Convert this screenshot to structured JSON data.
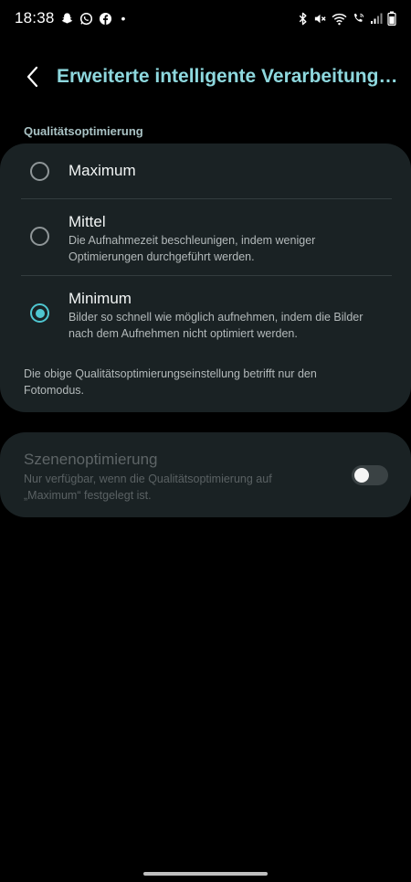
{
  "status_bar": {
    "time": "18:38",
    "left_icons": [
      "snapchat-icon",
      "whatsapp-icon",
      "facebook-icon",
      "notification-dot-icon"
    ],
    "right_icons": [
      "bluetooth-icon",
      "mute-icon",
      "wifi-icon",
      "wifi-call-icon",
      "signal-icon",
      "battery-icon"
    ],
    "dot": "•"
  },
  "header": {
    "back_icon": "chevron-left-icon",
    "title": "Erweiterte intelligente Verarbeitungso..."
  },
  "quality_section": {
    "label": "Qualitätsoptimierung",
    "options": [
      {
        "title": "Maximum",
        "description": "",
        "selected": false
      },
      {
        "title": "Mittel",
        "description": "Die Aufnahmezeit beschleunigen, indem weniger Optimierungen durchgeführt werden.",
        "selected": false
      },
      {
        "title": "Minimum",
        "description": "Bilder so schnell wie möglich aufnehmen, indem die Bilder nach dem Aufnehmen nicht optimiert werden.",
        "selected": true
      }
    ],
    "footnote": "Die obige Qualitätsoptimierungseinstellung betrifft nur den Fotomodus."
  },
  "scene_section": {
    "title": "Szenenoptimierung",
    "description": "Nur verfügbar, wenn die Qualitätsoptimierung auf „Maximum“ festgelegt ist.",
    "toggle_on": false,
    "enabled": false
  },
  "colors": {
    "accent": "#4fc6d0",
    "title": "#8ed8de",
    "card": "#1a2224",
    "background": "#000000"
  }
}
